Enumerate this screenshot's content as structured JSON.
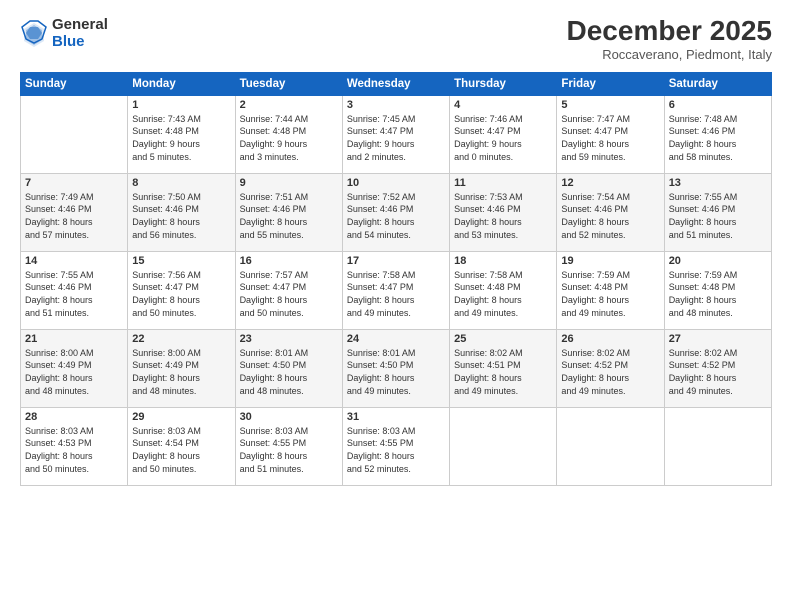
{
  "logo": {
    "general": "General",
    "blue": "Blue"
  },
  "header": {
    "month": "December 2025",
    "location": "Roccaverano, Piedmont, Italy"
  },
  "days_of_week": [
    "Sunday",
    "Monday",
    "Tuesday",
    "Wednesday",
    "Thursday",
    "Friday",
    "Saturday"
  ],
  "weeks": [
    [
      {
        "day": "",
        "content": ""
      },
      {
        "day": "1",
        "content": "Sunrise: 7:43 AM\nSunset: 4:48 PM\nDaylight: 9 hours\nand 5 minutes."
      },
      {
        "day": "2",
        "content": "Sunrise: 7:44 AM\nSunset: 4:48 PM\nDaylight: 9 hours\nand 3 minutes."
      },
      {
        "day": "3",
        "content": "Sunrise: 7:45 AM\nSunset: 4:47 PM\nDaylight: 9 hours\nand 2 minutes."
      },
      {
        "day": "4",
        "content": "Sunrise: 7:46 AM\nSunset: 4:47 PM\nDaylight: 9 hours\nand 0 minutes."
      },
      {
        "day": "5",
        "content": "Sunrise: 7:47 AM\nSunset: 4:47 PM\nDaylight: 8 hours\nand 59 minutes."
      },
      {
        "day": "6",
        "content": "Sunrise: 7:48 AM\nSunset: 4:46 PM\nDaylight: 8 hours\nand 58 minutes."
      }
    ],
    [
      {
        "day": "7",
        "content": "Sunrise: 7:49 AM\nSunset: 4:46 PM\nDaylight: 8 hours\nand 57 minutes."
      },
      {
        "day": "8",
        "content": "Sunrise: 7:50 AM\nSunset: 4:46 PM\nDaylight: 8 hours\nand 56 minutes."
      },
      {
        "day": "9",
        "content": "Sunrise: 7:51 AM\nSunset: 4:46 PM\nDaylight: 8 hours\nand 55 minutes."
      },
      {
        "day": "10",
        "content": "Sunrise: 7:52 AM\nSunset: 4:46 PM\nDaylight: 8 hours\nand 54 minutes."
      },
      {
        "day": "11",
        "content": "Sunrise: 7:53 AM\nSunset: 4:46 PM\nDaylight: 8 hours\nand 53 minutes."
      },
      {
        "day": "12",
        "content": "Sunrise: 7:54 AM\nSunset: 4:46 PM\nDaylight: 8 hours\nand 52 minutes."
      },
      {
        "day": "13",
        "content": "Sunrise: 7:55 AM\nSunset: 4:46 PM\nDaylight: 8 hours\nand 51 minutes."
      }
    ],
    [
      {
        "day": "14",
        "content": "Sunrise: 7:55 AM\nSunset: 4:46 PM\nDaylight: 8 hours\nand 51 minutes."
      },
      {
        "day": "15",
        "content": "Sunrise: 7:56 AM\nSunset: 4:47 PM\nDaylight: 8 hours\nand 50 minutes."
      },
      {
        "day": "16",
        "content": "Sunrise: 7:57 AM\nSunset: 4:47 PM\nDaylight: 8 hours\nand 50 minutes."
      },
      {
        "day": "17",
        "content": "Sunrise: 7:58 AM\nSunset: 4:47 PM\nDaylight: 8 hours\nand 49 minutes."
      },
      {
        "day": "18",
        "content": "Sunrise: 7:58 AM\nSunset: 4:48 PM\nDaylight: 8 hours\nand 49 minutes."
      },
      {
        "day": "19",
        "content": "Sunrise: 7:59 AM\nSunset: 4:48 PM\nDaylight: 8 hours\nand 49 minutes."
      },
      {
        "day": "20",
        "content": "Sunrise: 7:59 AM\nSunset: 4:48 PM\nDaylight: 8 hours\nand 48 minutes."
      }
    ],
    [
      {
        "day": "21",
        "content": "Sunrise: 8:00 AM\nSunset: 4:49 PM\nDaylight: 8 hours\nand 48 minutes."
      },
      {
        "day": "22",
        "content": "Sunrise: 8:00 AM\nSunset: 4:49 PM\nDaylight: 8 hours\nand 48 minutes."
      },
      {
        "day": "23",
        "content": "Sunrise: 8:01 AM\nSunset: 4:50 PM\nDaylight: 8 hours\nand 48 minutes."
      },
      {
        "day": "24",
        "content": "Sunrise: 8:01 AM\nSunset: 4:50 PM\nDaylight: 8 hours\nand 49 minutes."
      },
      {
        "day": "25",
        "content": "Sunrise: 8:02 AM\nSunset: 4:51 PM\nDaylight: 8 hours\nand 49 minutes."
      },
      {
        "day": "26",
        "content": "Sunrise: 8:02 AM\nSunset: 4:52 PM\nDaylight: 8 hours\nand 49 minutes."
      },
      {
        "day": "27",
        "content": "Sunrise: 8:02 AM\nSunset: 4:52 PM\nDaylight: 8 hours\nand 49 minutes."
      }
    ],
    [
      {
        "day": "28",
        "content": "Sunrise: 8:03 AM\nSunset: 4:53 PM\nDaylight: 8 hours\nand 50 minutes."
      },
      {
        "day": "29",
        "content": "Sunrise: 8:03 AM\nSunset: 4:54 PM\nDaylight: 8 hours\nand 50 minutes."
      },
      {
        "day": "30",
        "content": "Sunrise: 8:03 AM\nSunset: 4:55 PM\nDaylight: 8 hours\nand 51 minutes."
      },
      {
        "day": "31",
        "content": "Sunrise: 8:03 AM\nSunset: 4:55 PM\nDaylight: 8 hours\nand 52 minutes."
      },
      {
        "day": "",
        "content": ""
      },
      {
        "day": "",
        "content": ""
      },
      {
        "day": "",
        "content": ""
      }
    ]
  ]
}
